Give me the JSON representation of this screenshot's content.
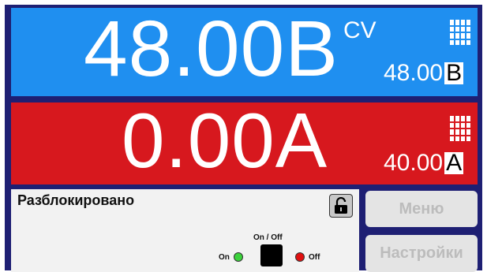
{
  "voltage": {
    "actual": "48.00В",
    "mode": "CV",
    "set_value": "48.00",
    "set_unit": "В",
    "keypad_icon": "keypad-icon"
  },
  "current": {
    "actual": "0.00A",
    "set_value": "40.00",
    "set_unit": "A",
    "keypad_icon": "keypad-icon"
  },
  "status": {
    "text": "Разблокировано",
    "lock_icon": "unlocked-padlock-icon",
    "onoff_label": "On / Off",
    "on_label": "On",
    "off_label": "Off"
  },
  "buttons": {
    "menu": "Меню",
    "settings": "Настройки"
  },
  "colors": {
    "frame": "#1e1f73",
    "voltage_panel": "#1f8ff0",
    "current_panel": "#d7181e",
    "status_bg": "#f2f2f2",
    "button_bg": "#e4e4e4",
    "button_text": "#bcbcbc",
    "led_on": "#3cd23c",
    "led_off": "#e01010"
  }
}
